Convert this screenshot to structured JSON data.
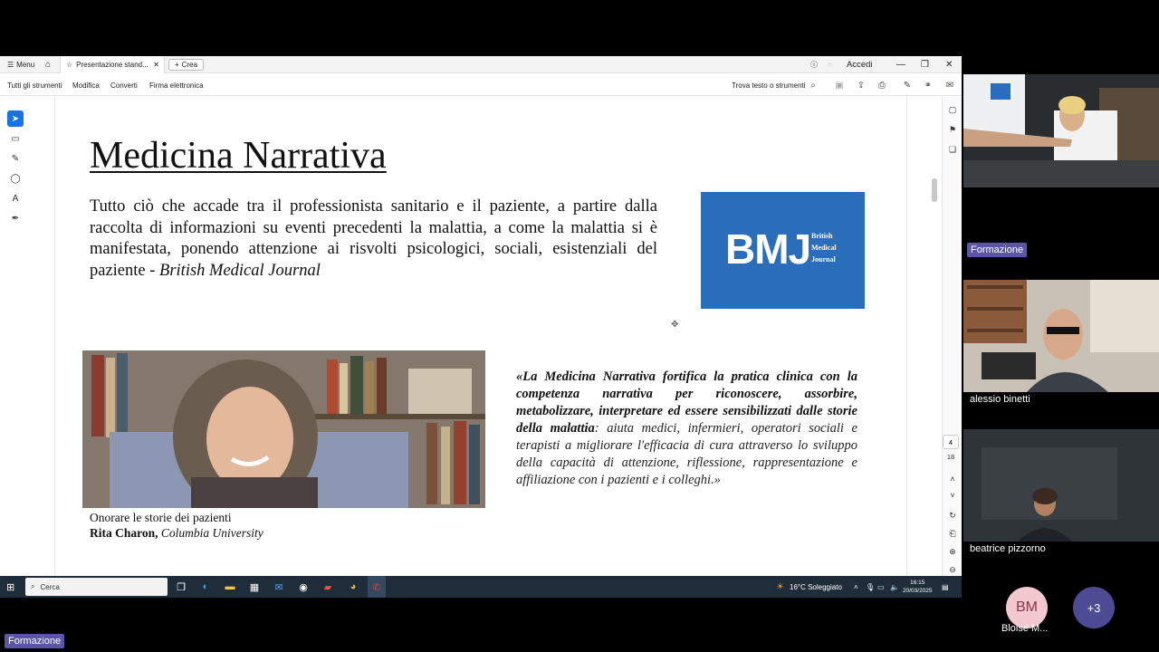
{
  "app": {
    "menu_label": "Menu",
    "tab_title": "Presentazione stand...",
    "new_tab_label": "Crea",
    "signin_label": "Accedi"
  },
  "toolbar": {
    "all_tools": "Tutti gli strumenti",
    "edit": "Modifica",
    "convert": "Converti",
    "esign": "Firma elettronica",
    "find_label": "Trova testo o strumenti"
  },
  "slide": {
    "title": "Medicina Narrativa",
    "paragraph": "Tutto ciò che accade tra il professionista sanitario e il paziente, a partire dalla raccolta di informazioni su eventi precedenti la malattia, a come la malattia si è manifestata, ponendo attenzione ai risvolti psicologici, sociali, esistenziali del paziente - ",
    "paragraph_source": "British Medical Journal",
    "logo_letters": "BMJ",
    "logo_line1": "British",
    "logo_line2": "Medical",
    "logo_line3": "Journal",
    "caption_line1": "Onorare le storie dei pazienti",
    "caption_name": "Rita Charon,",
    "caption_affiliation": "Columbia University",
    "quote_bold": "«La Medicina Narrativa fortifica la pratica clinica con la competenza narrativa per riconoscere, assorbire, metabolizzare, interpretare ed essere sensibilizzati dalle storie della malattia",
    "quote_rest": ": aiuta medici, infermieri, operatori sociali e terapisti a migliorare l'efficacia di cura attraverso lo sviluppo della capacità di attenzione, riflessione, rappresentazione e affiliazione con i pazienti e i colleghi.»"
  },
  "pager": {
    "current": "4",
    "total": "18"
  },
  "taskbar": {
    "search_placeholder": "Cerca",
    "weather": "16°C  Soleggiato",
    "time": "16:15",
    "date": "20/03/2025"
  },
  "participants": {
    "presenter_badge": "Formazione",
    "p2": "alessio binetti",
    "p3": "beatrice pizzorno",
    "p4_initials": "BM",
    "p4_name": "Bloise M...",
    "more": "+3",
    "self_badge": "Formazione"
  },
  "colors": {
    "accent": "#1473e6",
    "bmj_blue": "#2a6ebb",
    "badge": "#5b56a8"
  }
}
